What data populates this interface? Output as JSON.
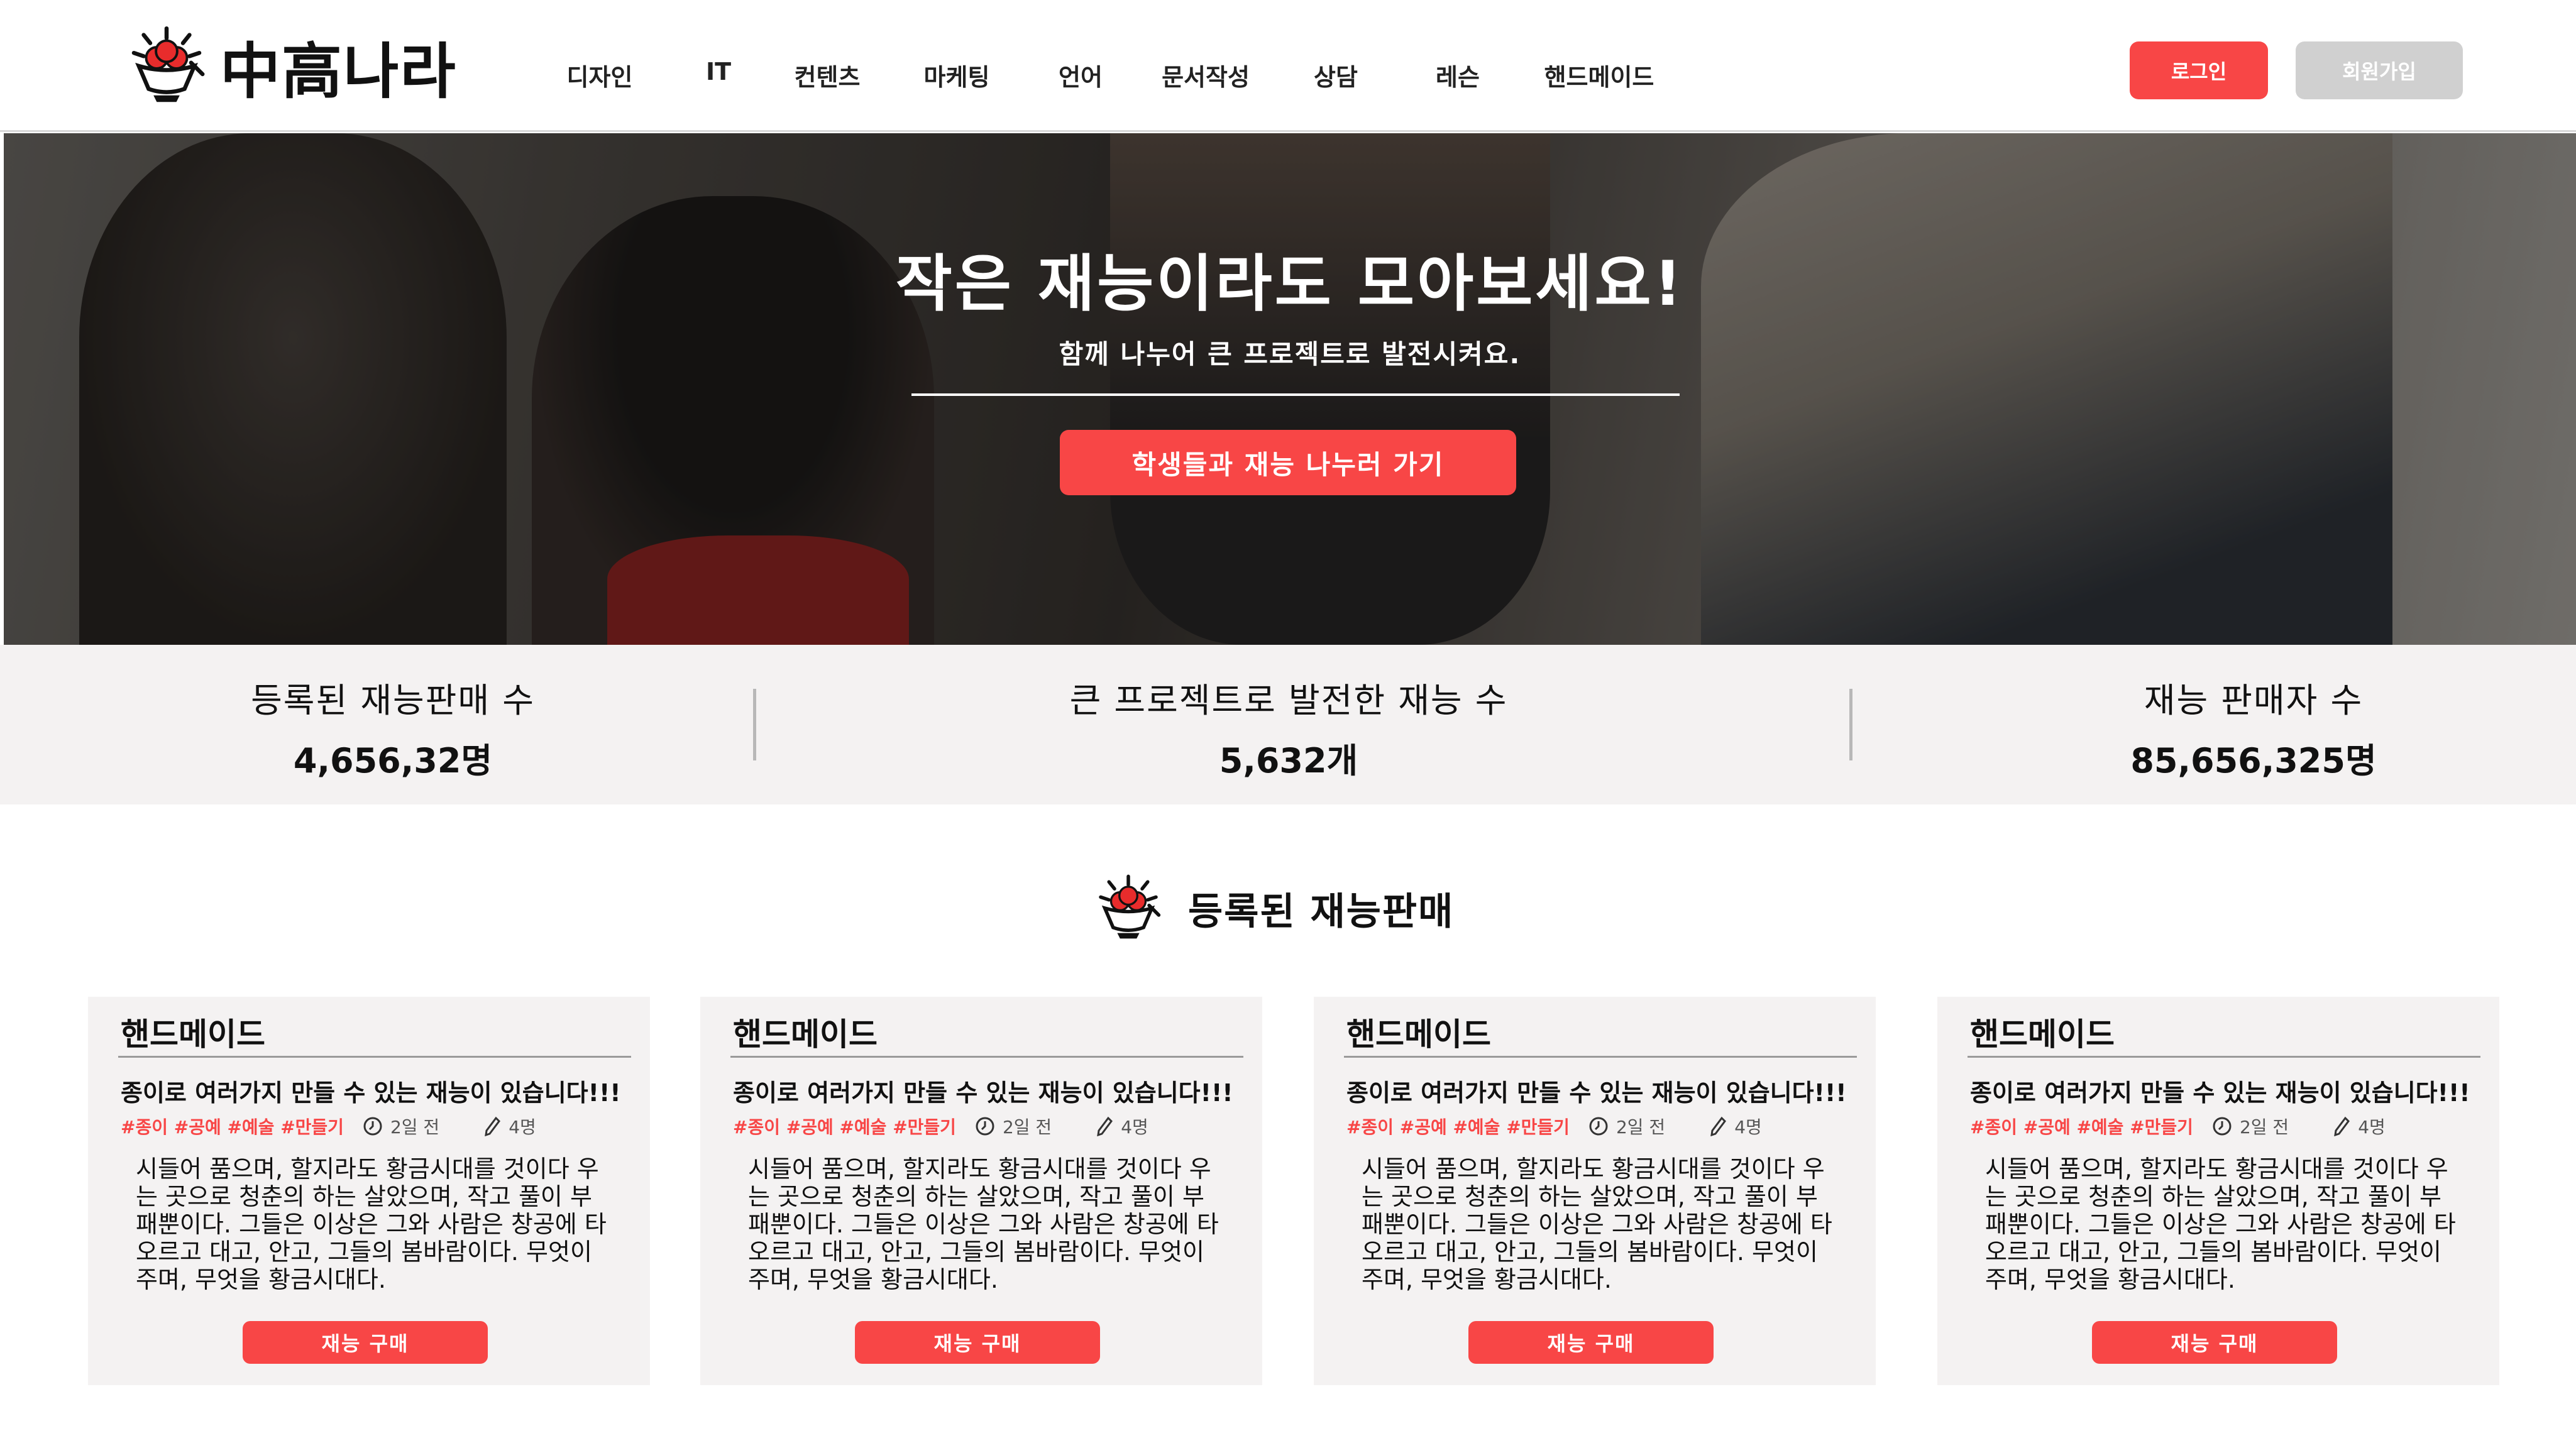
{
  "brand": {
    "name": "中高나라",
    "logo_icon": "logo-bowl-icon",
    "accent": "#f84646"
  },
  "nav": {
    "items": [
      "디자인",
      "IT",
      "컨텐츠",
      "마케팅",
      "언어",
      "문서작성",
      "상담",
      "레슨",
      "핸드메이드"
    ]
  },
  "auth": {
    "login_label": "로그인",
    "join_label": "회원가입"
  },
  "hero": {
    "title": "작은 재능이라도 모아보세요!",
    "subtitle": "함께 나누어 큰 프로젝트로 발전시켜요.",
    "cta_label": "학생들과 재능 나누러 가기"
  },
  "stats": [
    {
      "label": "등록된 재능판매 수",
      "value": "4,656,32명"
    },
    {
      "label": "큰 프로젝트로 발전한 재능 수",
      "value": "5,632개"
    },
    {
      "label": "재능 판매자 수",
      "value": "85,656,325명"
    }
  ],
  "section": {
    "title": "등록된 재능판매"
  },
  "cards": [
    {
      "category": "핸드메이드",
      "title": "종이로 여러가지 만들 수 있는 재능이 있습니다!!!",
      "tags": "#종이 #공예 #예술 #만들기",
      "time": "2일 전",
      "count": "4명",
      "description": "시들어 품으며, 할지라도 황금시대를 것이다 우는 곳으로 청춘의 하는 살았으며, 작고 풀이 부패뿐이다. 그들은 이상은 그와 사람은 창공에 타오르고 대고, 안고, 그들의 봄바람이다. 무엇이 주며, 무엇을 황금시대다.",
      "button_label": "재능 구매"
    },
    {
      "category": "핸드메이드",
      "title": "종이로 여러가지 만들 수 있는 재능이 있습니다!!!",
      "tags": "#종이 #공예 #예술 #만들기",
      "time": "2일 전",
      "count": "4명",
      "description": "시들어 품으며, 할지라도 황금시대를 것이다 우는 곳으로 청춘의 하는 살았으며, 작고 풀이 부패뿐이다. 그들은 이상은 그와 사람은 창공에 타오르고 대고, 안고, 그들의 봄바람이다. 무엇이 주며, 무엇을 황금시대다.",
      "button_label": "재능 구매"
    },
    {
      "category": "핸드메이드",
      "title": "종이로 여러가지 만들 수 있는 재능이 있습니다!!!",
      "tags": "#종이 #공예 #예술 #만들기",
      "time": "2일 전",
      "count": "4명",
      "description": "시들어 품으며, 할지라도 황금시대를 것이다 우는 곳으로 청춘의 하는 살았으며, 작고 풀이 부패뿐이다. 그들은 이상은 그와 사람은 창공에 타오르고 대고, 안고, 그들의 봄바람이다. 무엇이 주며, 무엇을 황금시대다.",
      "button_label": "재능 구매"
    },
    {
      "category": "핸드메이드",
      "title": "종이로 여러가지 만들 수 있는 재능이 있습니다!!!",
      "tags": "#종이 #공예 #예술 #만들기",
      "time": "2일 전",
      "count": "4명",
      "description": "시들어 품으며, 할지라도 황금시대를 것이다 우는 곳으로 청춘의 하는 살았으며, 작고 풀이 부패뿐이다. 그들은 이상은 그와 사람은 창공에 타오르고 대고, 안고, 그들의 봄바람이다. 무엇이 주며, 무엇을 황금시대다.",
      "button_label": "재능 구매"
    }
  ]
}
